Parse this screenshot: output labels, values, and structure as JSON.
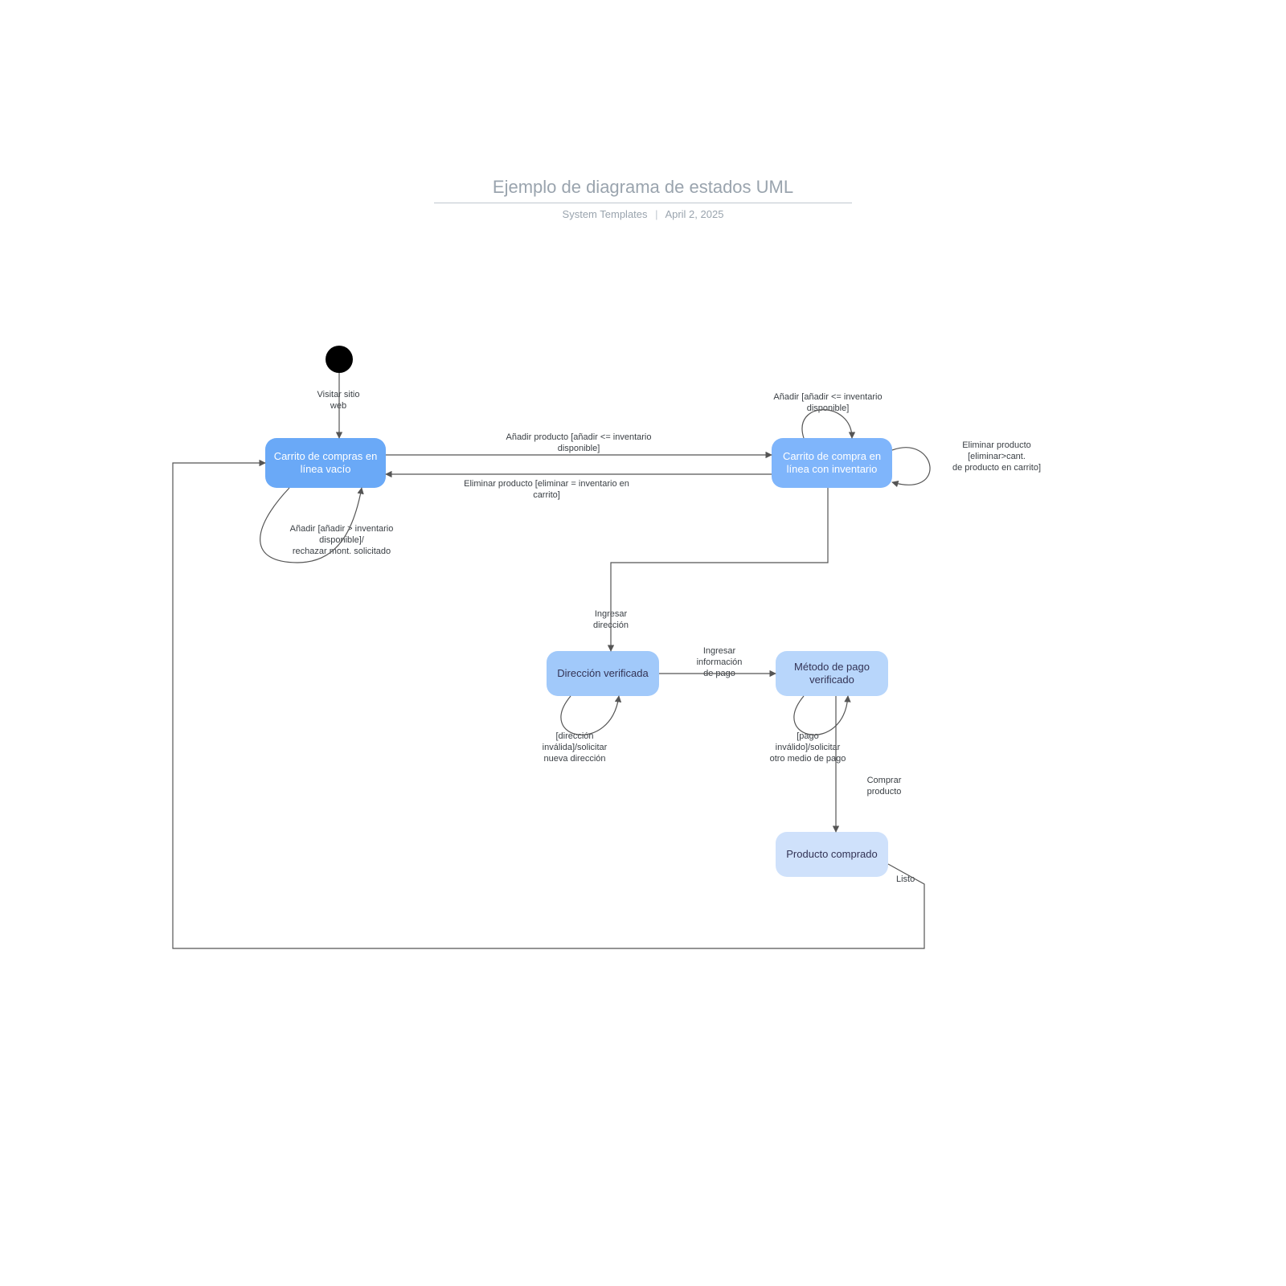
{
  "header": {
    "title": "Ejemplo de diagrama de estados UML",
    "subtitle_left": "System Templates",
    "subtitle_right": "April 2, 2025"
  },
  "states": {
    "empty_cart": "Carrito de\ncompras en línea\nvacío",
    "full_cart": "Carrito de compra\nen línea con\ninventario",
    "address": "Dirección\nverificada",
    "payment": "Método de pago\nverificado",
    "purchased": "Producto\ncomprado"
  },
  "transitions": {
    "visit_site": "Visitar sitio\nweb",
    "add_product_ok": "Añadir producto [añadir <= inventario\ndisponible]",
    "remove_all": "Eliminar producto [eliminar = inventario en\ncarrito]",
    "add_reject": "Añadir [añadir > inventario\ndisponible]/\nrechazar mont. solicitado",
    "add_self": "Añadir [añadir <= inventario\ndisponible]",
    "remove_self": "Eliminar producto\n[eliminar>cant.\nde producto en carrito]",
    "enter_address": "Ingresar\ndirección",
    "invalid_address": "[dirección\ninválida]/solicitar\nnueva dirección",
    "enter_payment": "Ingresar\ninformación\nde pago",
    "invalid_payment": "[pago\ninválido]/solicitar\notro medio de pago",
    "buy": "Comprar\nproducto",
    "done": "Listo"
  },
  "chart_data": {
    "type": "uml-state-machine",
    "initial": "empty_cart",
    "states": [
      {
        "id": "empty_cart",
        "label": "Carrito de compras en línea vacío"
      },
      {
        "id": "full_cart",
        "label": "Carrito de compra en línea con inventario"
      },
      {
        "id": "address",
        "label": "Dirección verificada"
      },
      {
        "id": "payment",
        "label": "Método de pago verificado"
      },
      {
        "id": "purchased",
        "label": "Producto comprado"
      }
    ],
    "transitions": [
      {
        "from": "__initial__",
        "to": "empty_cart",
        "label": "Visitar sitio web"
      },
      {
        "from": "empty_cart",
        "to": "full_cart",
        "label": "Añadir producto [añadir <= inventario disponible]"
      },
      {
        "from": "full_cart",
        "to": "empty_cart",
        "label": "Eliminar producto [eliminar = inventario en carrito]"
      },
      {
        "from": "empty_cart",
        "to": "empty_cart",
        "label": "Añadir [añadir > inventario disponible]/rechazar mont. solicitado"
      },
      {
        "from": "full_cart",
        "to": "full_cart",
        "label": "Añadir [añadir <= inventario disponible]"
      },
      {
        "from": "full_cart",
        "to": "full_cart",
        "label": "Eliminar producto [eliminar>cant. de producto en carrito]"
      },
      {
        "from": "full_cart",
        "to": "address",
        "label": "Ingresar dirección"
      },
      {
        "from": "address",
        "to": "address",
        "label": "[dirección inválida]/solicitar nueva dirección"
      },
      {
        "from": "address",
        "to": "payment",
        "label": "Ingresar información de pago"
      },
      {
        "from": "payment",
        "to": "payment",
        "label": "[pago inválido]/solicitar otro medio de pago"
      },
      {
        "from": "payment",
        "to": "purchased",
        "label": "Comprar producto"
      },
      {
        "from": "purchased",
        "to": "empty_cart",
        "label": "Listo"
      }
    ]
  }
}
